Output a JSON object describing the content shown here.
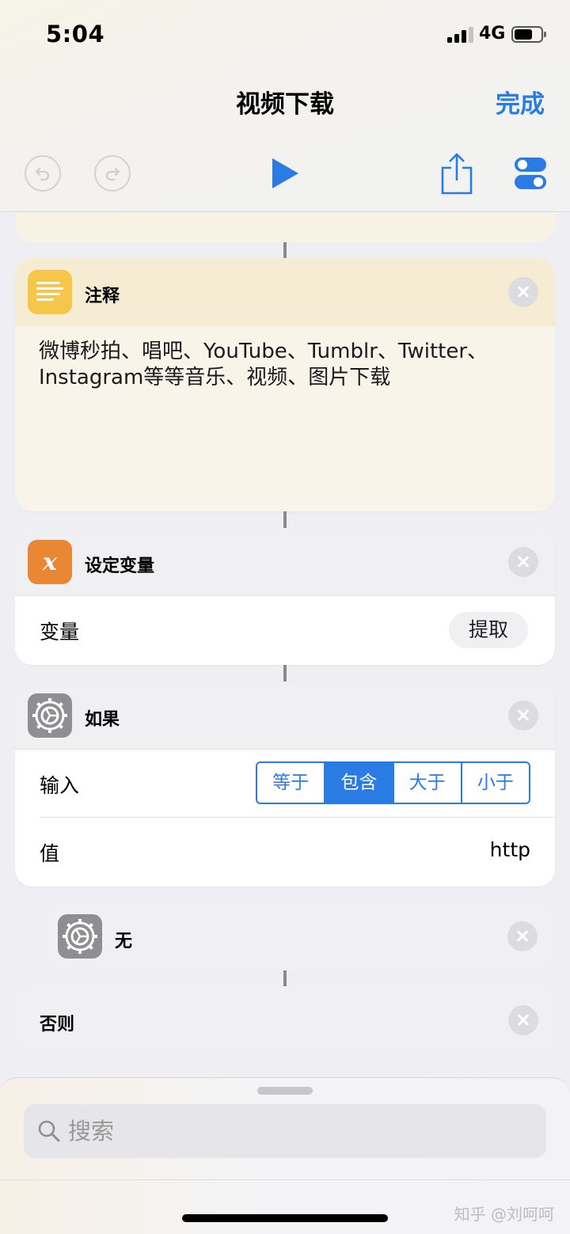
{
  "status_bar": {
    "time": "5:04",
    "network": "4G",
    "battery_level": 0.65
  },
  "nav": {
    "title": "视频下载",
    "done_label": "完成"
  },
  "actions": [
    {
      "title": "注释",
      "icon": "text-lines-icon",
      "icon_color": "#f6c64a",
      "text": "微博秒拍、唱吧、YouTube、Tumblr、Twitter、Instagram等等音乐、视频、图片下载"
    },
    {
      "title": "设定变量",
      "icon": "variable-x-icon",
      "icon_color": "#e98735",
      "rows": [
        {
          "label": "变量",
          "value": "提取"
        }
      ]
    },
    {
      "title": "如果",
      "icon": "gear-icon",
      "icon_color": "#8e8e93",
      "input_label": "输入",
      "options": [
        "等于",
        "包含",
        "大于",
        "小于"
      ],
      "selected_option": "包含",
      "value_label": "值",
      "value": "http"
    },
    {
      "title": "无",
      "icon": "gear-icon"
    },
    {
      "title": "否则"
    }
  ],
  "search": {
    "placeholder": "搜索"
  },
  "watermark": "知乎 @刘呵呵",
  "colors": {
    "accent": "#2a7be4",
    "comment_header": "#f5ecd3",
    "comment_body": "#f8f4ea"
  }
}
